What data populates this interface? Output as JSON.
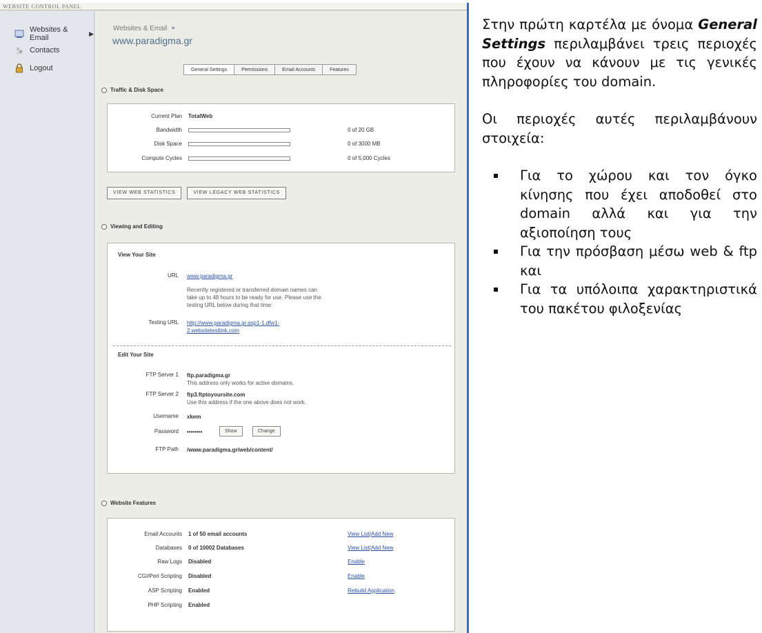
{
  "panel": {
    "header": "WEBSITE CONTROL PANEL",
    "nav": [
      {
        "label": "Websites & Email",
        "icon": "websites-icon",
        "arrow": "▶"
      },
      {
        "label": "Contacts",
        "icon": "contacts-icon"
      },
      {
        "label": "Logout",
        "icon": "lock-icon"
      }
    ],
    "breadcrumb": "Websites & Email",
    "breadcrumb_plus": "+",
    "site_title": "www.paradigma.gr",
    "tabs": [
      "General Settings",
      "Permissions",
      "Email Accounts",
      "Features"
    ],
    "active_tab": "General Settings"
  },
  "traffic": {
    "heading": "Traffic & Disk Space",
    "plan_label": "Current Plan",
    "plan_value": "TotalWeb",
    "rows": [
      {
        "label": "Bandwidth",
        "usage": "0 of 20 GB",
        "fraction": 0
      },
      {
        "label": "Disk Space",
        "usage": "0 of 3000 MB",
        "fraction": 0
      },
      {
        "label": "Compute Cycles",
        "usage": "0 of 5,000 Cycles",
        "fraction": 0
      }
    ],
    "buttons": [
      "VIEW WEB STATISTICS",
      "VIEW LEGACY WEB STATISTICS"
    ]
  },
  "viewing": {
    "heading": "Viewing and Editing",
    "view_head": "View Your Site",
    "url_label": "URL",
    "url_value": "www.paradigma.gr",
    "url_note_1": "Recently registered or transferred domain names can",
    "url_note_2": "take up to 48 hours to be ready for use. Please use the",
    "url_note_3": "testing URL below during that time:",
    "testing_label": "Testing URL",
    "testing_value_1": "http://www.paradigma.gr.asp1-1.dfw1-",
    "testing_value_2": "2.websitetestlink.com",
    "edit_head": "Edit Your Site",
    "ftp1_label": "FTP Server 1",
    "ftp1_value": "ftp.paradigma.gr",
    "ftp1_note": "This address only works for active domains.",
    "ftp2_label": "FTP Server 2",
    "ftp2_value": "ftp3.ftptoyoursite.com",
    "ftp2_note": "Use this address if the one above does not work.",
    "user_label": "Username",
    "user_value": "xkem",
    "pass_label": "Password",
    "pass_value": "••••••••",
    "show_btn": "Show",
    "change_btn": "Change",
    "path_label": "FTP Path",
    "path_value": "/www.paradigma.gr/web/content/"
  },
  "features": {
    "heading": "Website Features",
    "rows": [
      {
        "label": "Email Accounts",
        "value": "1 of 50 email accounts",
        "action": "View List",
        "action2": "Add New"
      },
      {
        "label": "Databases",
        "value": "0 of 10002 Databases",
        "action": "View List",
        "action2": "Add New"
      },
      {
        "label": "Raw Logs",
        "value": "Disabled",
        "action": "Enable"
      },
      {
        "label": "CGI/Perl Scripting",
        "value": "Disabled",
        "action": "Enable"
      },
      {
        "label": "ASP Scripting",
        "value": "Enabled",
        "action": "Rebuild Application"
      },
      {
        "label": "PHP Scripting",
        "value": "Enabled"
      }
    ]
  },
  "text": {
    "p1_start": "Στην πρώτη καρτέλα με όνομα ",
    "p1_em": "General Settings",
    "p1_end": " περιλαμβάνει τρεις περιοχές που έχουν να κάνουν με τις γενικές πληροφορίες του domain.",
    "p2": "Οι περιοχές αυτές περιλαμβάνουν στοιχεία:",
    "bullets": [
      "Για το χώρου και τον όγκο κίνησης που έχει αποδοθεί στο domain αλλά και για την αξιοποίηση τους",
      "Για την πρόσβαση μέσω web & ftp και",
      "Για τα υπόλοιπα χαρακτηριστικά του πακέτου φιλοξενίας"
    ]
  },
  "colors": {
    "accent_border": "#3b6bb0",
    "link": "#2a50a8",
    "title": "#4c6e8c"
  }
}
